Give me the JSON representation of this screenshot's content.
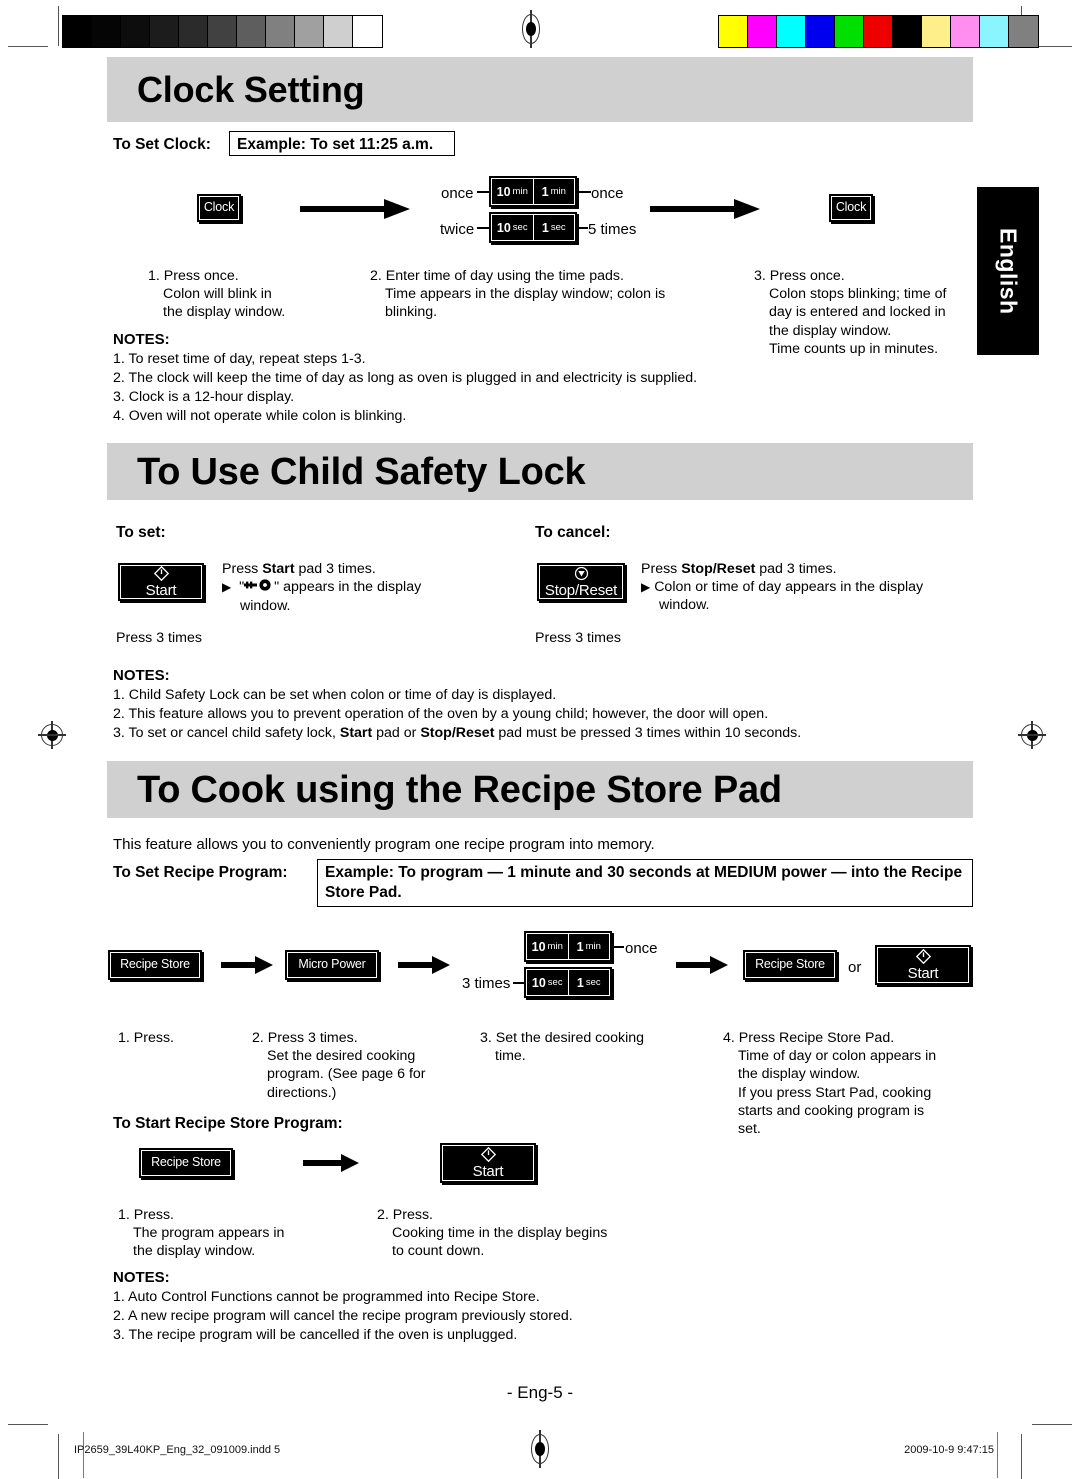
{
  "print_marks": {
    "grayscale_patches": [
      "#000000",
      "#050505",
      "#0d0d0d",
      "#1c1c1c",
      "#2b2b2b",
      "#414141",
      "#5e5e5e",
      "#808080",
      "#a0a0a0",
      "#cfcfcf",
      "#ffffff"
    ],
    "color_patches": [
      "#ffff00",
      "#ff00ff",
      "#00ffff",
      "#0000ee",
      "#00e000",
      "#ee0000",
      "#000000",
      "#ffef8a",
      "#ff8ef0",
      "#8af4ff",
      "#808080"
    ]
  },
  "side_tab": {
    "label": "English"
  },
  "sections": [
    {
      "id": "clock-setting",
      "title": "Clock Setting",
      "subtitle_label": "To Set Clock:",
      "example_box": "Example: To set 11:25 a.m.",
      "pads": {
        "clock_left": "Clock",
        "clock_right": "Clock",
        "time_top": [
          {
            "num": "10",
            "unit": "min"
          },
          {
            "num": "1",
            "unit": "min"
          }
        ],
        "time_bottom": [
          {
            "num": "10",
            "unit": "sec"
          },
          {
            "num": "1",
            "unit": "sec"
          }
        ]
      },
      "connector_labels": {
        "top_left": "once",
        "top_right": "once",
        "bottom_left": "twice",
        "bottom_right": "5 times"
      },
      "steps": [
        {
          "num": "1.",
          "lines": [
            "Press once.",
            "Colon will blink in",
            "the display window."
          ]
        },
        {
          "num": "2.",
          "lines": [
            "Enter time of day using the time pads.",
            "Time appears in the display window; colon is",
            "blinking."
          ]
        },
        {
          "num": "3.",
          "lines": [
            "Press once.",
            "Colon stops blinking; time of",
            "day is entered and locked in",
            "the display window.",
            "Time counts up in minutes."
          ]
        }
      ],
      "notes_head": "NOTES:",
      "notes": [
        "1. To reset time of day, repeat steps 1-3.",
        "2. The clock will keep the time of day as long as oven is plugged in and electricity is supplied.",
        "3. Clock is a 12-hour display.",
        "4. Oven will not operate while colon is blinking."
      ]
    },
    {
      "id": "child-safety-lock",
      "title": "To Use Child Safety Lock",
      "set_label": "To set:",
      "cancel_label": "To cancel:",
      "set_pad": {
        "caption": "Start",
        "icon": "power-diamond-icon"
      },
      "cancel_pad": {
        "caption": "Stop/Reset",
        "icon": "stop-circle-icon"
      },
      "set_text": {
        "line1_pre": "Press ",
        "line1_bold": "Start",
        "line1_post": " pad 3 times.",
        "line2_pre": " \"",
        "line2_icon": "key-icon",
        "line2_post": "\" appears in the display",
        "line3": "window."
      },
      "cancel_text": {
        "line1_pre": "Press ",
        "line1_bold": "Stop/Reset",
        "line1_post": " pad 3 times.",
        "line2": "Colon or time of day appears in the display",
        "line3": "window."
      },
      "press_3_times_set": "Press 3 times",
      "press_3_times_cancel": "Press 3 times",
      "notes_head": "NOTES:",
      "notes": [
        "1. Child Safety Lock can be set when colon or time of day is displayed.",
        "2. This feature allows you to prevent operation of the oven by a young child; however, the door will open."
      ],
      "note3": {
        "pre": "3. To set or cancel child safety lock, ",
        "bold1": "Start",
        "mid": " pad or ",
        "bold2": "Stop/Reset",
        "post": " pad must be pressed 3 times within 10 seconds."
      }
    },
    {
      "id": "recipe-store-pad",
      "title": "To Cook using the Recipe Store Pad",
      "intro": "This feature allows you to conveniently program one recipe program into memory.",
      "subtitle_label": "To Set Recipe Program:",
      "example_box_line1": "Example: To program — 1 minute and 30 seconds at MEDIUM power — into the",
      "example_box_line2": "Recipe Store Pad.",
      "pads": {
        "recipe_store_1": "Recipe Store",
        "micro_power": "Micro Power",
        "recipe_store_2": "Recipe Store",
        "or_label": "or",
        "start": {
          "caption": "Start",
          "icon": "power-diamond-icon"
        },
        "time_top": [
          {
            "num": "10",
            "unit": "min"
          },
          {
            "num": "1",
            "unit": "min"
          }
        ],
        "time_bottom": [
          {
            "num": "10",
            "unit": "sec"
          },
          {
            "num": "1",
            "unit": "sec"
          }
        ]
      },
      "connector_labels": {
        "top_right": "once",
        "bottom_left": "3 times"
      },
      "steps": [
        {
          "num": "1.",
          "lines": [
            "Press."
          ]
        },
        {
          "num": "2.",
          "lines": [
            "Press 3 times.",
            "Set the desired cooking",
            "program. (See page 6 for",
            "directions.)"
          ]
        },
        {
          "num": "3.",
          "lines": [
            "Set the desired cooking",
            "time."
          ]
        },
        {
          "num": "4.",
          "lines": [
            "Press Recipe Store Pad.",
            "Time of day or colon appears in",
            "the display window.",
            "If you press Start Pad, cooking",
            "starts and cooking program is",
            "set."
          ]
        }
      ],
      "start_program_label": "To Start Recipe Store Program:",
      "start_program_pads": {
        "recipe_store": "Recipe Store",
        "start": {
          "caption": "Start",
          "icon": "power-diamond-icon"
        }
      },
      "start_program_steps": [
        {
          "num": "1.",
          "lines": [
            "Press.",
            "The program appears in",
            "the display window."
          ]
        },
        {
          "num": "2.",
          "lines": [
            "Press.",
            "Cooking time in the display begins",
            "to count down."
          ]
        }
      ],
      "notes_head": "NOTES:",
      "notes": [
        "1. Auto Control Functions cannot be programmed into Recipe Store.",
        "2. A new recipe program will cancel the recipe program previously stored.",
        "3. The recipe program will be cancelled if the oven is unplugged."
      ]
    }
  ],
  "footer": {
    "page_number": "- Eng-5 -",
    "file_name": "IP2659_39L40KP_Eng_32_091009.indd   5",
    "timestamp": "2009-10-9   9:47:15"
  }
}
